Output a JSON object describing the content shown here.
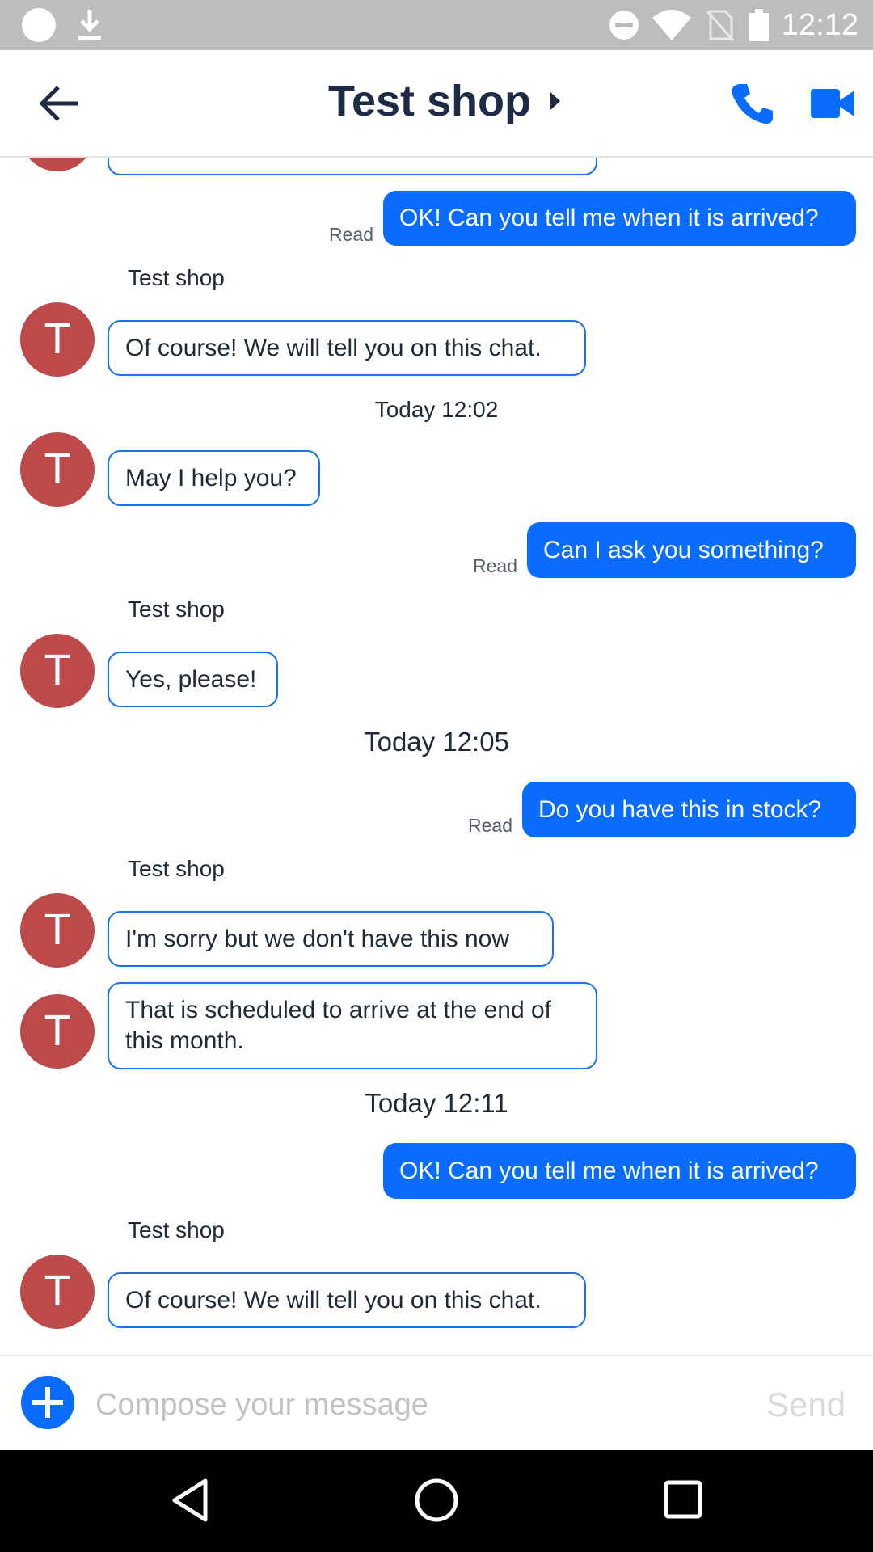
{
  "status_bar": {
    "time": "12:12"
  },
  "header": {
    "title": "Test shop"
  },
  "messages": {
    "partial_incoming": "",
    "out_1": "OK! Can you tell me when it is arrived?",
    "read_1": "Read",
    "sender_1": "Test shop",
    "in_1": "Of course! We will tell you on this chat.",
    "ts_1": "Today 12:02",
    "in_2": "May I help you?",
    "out_2": "Can I ask you something?",
    "read_2": "Read",
    "sender_2": "Test shop",
    "in_3": "Yes, please!",
    "ts_2": "Today 12:05",
    "out_3": "Do you have this in stock?",
    "read_3": "Read",
    "sender_3": "Test shop",
    "in_4": "I'm sorry but we don't have this now",
    "in_5": "That is scheduled to arrive at the end of this month.",
    "ts_3": "Today 12:11",
    "out_4": "OK! Can you tell me when it is arrived?",
    "sender_4": "Test shop",
    "in_6": "Of course! We will tell you on this chat."
  },
  "avatar_letter": "T",
  "compose": {
    "placeholder": "Compose your message",
    "send_label": "Send"
  },
  "colors": {
    "accent": "#0a6cff",
    "avatar": "#bd4a4a",
    "status_bar": "#bdbdbd"
  },
  "icons": [
    "download-icon",
    "dnd-icon",
    "wifi-icon",
    "no-sim-icon",
    "battery-icon",
    "back-arrow-icon",
    "caret-right-icon",
    "phone-icon",
    "video-icon",
    "plus-icon",
    "nav-back-icon",
    "nav-home-icon",
    "nav-recents-icon"
  ]
}
